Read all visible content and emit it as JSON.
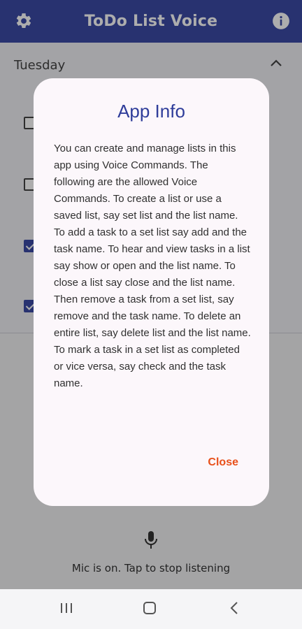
{
  "app_bar": {
    "title": "ToDo List Voice",
    "settings_icon": "gear-icon",
    "info_icon": "info-icon",
    "color": "#3b4aa6"
  },
  "list": {
    "section_header": "Tuesday",
    "tasks": [
      {
        "checked": false
      },
      {
        "checked": false
      },
      {
        "checked": true
      },
      {
        "checked": true
      }
    ]
  },
  "mic": {
    "icon": "mic-icon",
    "status_text": "Mic is on. Tap to stop listening"
  },
  "dialog": {
    "title": "App Info",
    "body": "You can create and manage lists in this app using Voice Commands. The following are the allowed Voice Commands. To create a list or use a saved list, say set list and the list name. To add a task to a set list say add and the task name. To hear and view tasks in a list say show or open and the list name. To close a list say close and the list name. Then remove a task from a set list, say remove and the task name. To delete an entire list, say delete list and the list name. To mark a task in a set list as completed or vice versa, say check and the task name.",
    "close_label": "Close",
    "accent": "#e8501a"
  },
  "system_nav": {
    "recents_icon": "recents-icon",
    "home_icon": "home-icon",
    "back_icon": "back-icon"
  }
}
